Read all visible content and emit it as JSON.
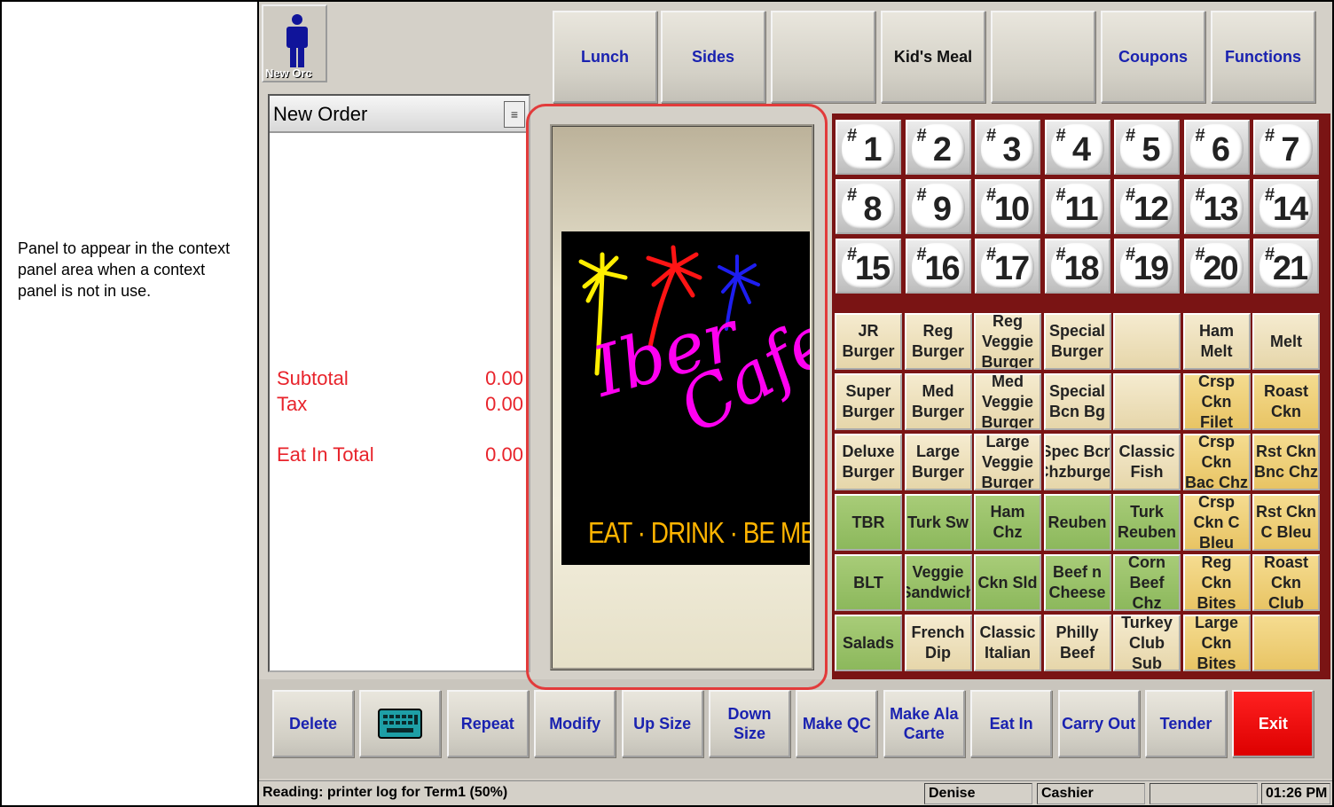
{
  "annotation": "Panel to appear in the context panel area when a context panel is not in use.",
  "new_order_button": {
    "label": "New Orc"
  },
  "top_tabs": [
    {
      "label": "Lunch"
    },
    {
      "label": "Sides"
    },
    {
      "label": ""
    },
    {
      "label": "Kid's Meal"
    },
    {
      "label": ""
    },
    {
      "label": "Coupons"
    },
    {
      "label": "Functions"
    }
  ],
  "order": {
    "title": "New Order",
    "subtotal_label": "Subtotal",
    "subtotal": "0.00",
    "tax_label": "Tax",
    "tax": "0.00",
    "total_label": "Eat In Total",
    "total": "0.00"
  },
  "logo": {
    "line1": "Iber",
    "line2": "Cafe",
    "tagline": "EAT · DRINK · BE MERRY"
  },
  "combo_numbers": [
    "1",
    "2",
    "3",
    "4",
    "5",
    "6",
    "7",
    "8",
    "9",
    "10",
    "11",
    "12",
    "13",
    "14",
    "15",
    "16",
    "17",
    "18",
    "19",
    "20",
    "21"
  ],
  "menu_items": [
    {
      "label": "JR Burger",
      "style": "cream"
    },
    {
      "label": "Reg Burger",
      "style": "cream"
    },
    {
      "label": "Reg Veggie Burger",
      "style": "cream"
    },
    {
      "label": "Special Burger",
      "style": "cream"
    },
    {
      "label": "",
      "style": "cream"
    },
    {
      "label": "Ham Melt",
      "style": "cream"
    },
    {
      "label": "Melt",
      "style": "cream"
    },
    {
      "label": "Super Burger",
      "style": "cream"
    },
    {
      "label": "Med Burger",
      "style": "cream"
    },
    {
      "label": "Med Veggie Burger",
      "style": "cream"
    },
    {
      "label": "Special Bcn Bg",
      "style": "cream"
    },
    {
      "label": "",
      "style": "cream"
    },
    {
      "label": "Crsp Ckn Filet",
      "style": "gold"
    },
    {
      "label": "Roast Ckn",
      "style": "gold"
    },
    {
      "label": "Deluxe Burger",
      "style": "cream"
    },
    {
      "label": "Large Burger",
      "style": "cream"
    },
    {
      "label": "Large Veggie Burger",
      "style": "cream"
    },
    {
      "label": "Spec Bcn Chzburger",
      "style": "cream"
    },
    {
      "label": "Classic Fish",
      "style": "cream"
    },
    {
      "label": "Crsp Ckn Bac Chz",
      "style": "gold"
    },
    {
      "label": "Rst Ckn Bnc Chz",
      "style": "gold"
    },
    {
      "label": "TBR",
      "style": "green"
    },
    {
      "label": "Turk Sw",
      "style": "green"
    },
    {
      "label": "Ham Chz",
      "style": "green"
    },
    {
      "label": "Reuben",
      "style": "green"
    },
    {
      "label": "Turk Reuben",
      "style": "green"
    },
    {
      "label": "Crsp Ckn C Bleu",
      "style": "gold"
    },
    {
      "label": "Rst Ckn C Bleu",
      "style": "gold"
    },
    {
      "label": "BLT",
      "style": "green"
    },
    {
      "label": "Veggie Sandwich",
      "style": "green"
    },
    {
      "label": "Ckn Sld",
      "style": "green"
    },
    {
      "label": "Beef n Cheese",
      "style": "green"
    },
    {
      "label": "Corn Beef Chz",
      "style": "green"
    },
    {
      "label": "Reg Ckn Bites",
      "style": "gold"
    },
    {
      "label": "Roast Ckn Club",
      "style": "gold"
    },
    {
      "label": "Salads",
      "style": "green"
    },
    {
      "label": "French Dip",
      "style": "cream"
    },
    {
      "label": "Classic Italian",
      "style": "cream"
    },
    {
      "label": "Philly Beef",
      "style": "cream"
    },
    {
      "label": "Turkey Club Sub",
      "style": "cream"
    },
    {
      "label": "Large Ckn Bites",
      "style": "gold"
    },
    {
      "label": "",
      "style": "gold"
    }
  ],
  "bottom_buttons": [
    {
      "label": "Delete"
    },
    {
      "label": "",
      "icon": "keyboard-icon"
    },
    {
      "label": "Repeat"
    },
    {
      "label": "Modify"
    },
    {
      "label": "Up Size"
    },
    {
      "label": "Down Size"
    },
    {
      "label": "Make QC"
    },
    {
      "label": "Make Ala Carte"
    },
    {
      "label": "Eat In"
    },
    {
      "label": "Carry Out"
    },
    {
      "label": "Tender"
    },
    {
      "label": "Exit"
    }
  ],
  "status_bar": {
    "message": "Reading: printer log for Term1 (50%)",
    "user": "Denise",
    "role": "Cashier",
    "extra": "",
    "time": "01:26 PM"
  },
  "colors": {
    "exit": "#ff0000",
    "summary_text": "#e8232b",
    "button_text": "#1a22b0",
    "menu_background": "#7a1414"
  }
}
